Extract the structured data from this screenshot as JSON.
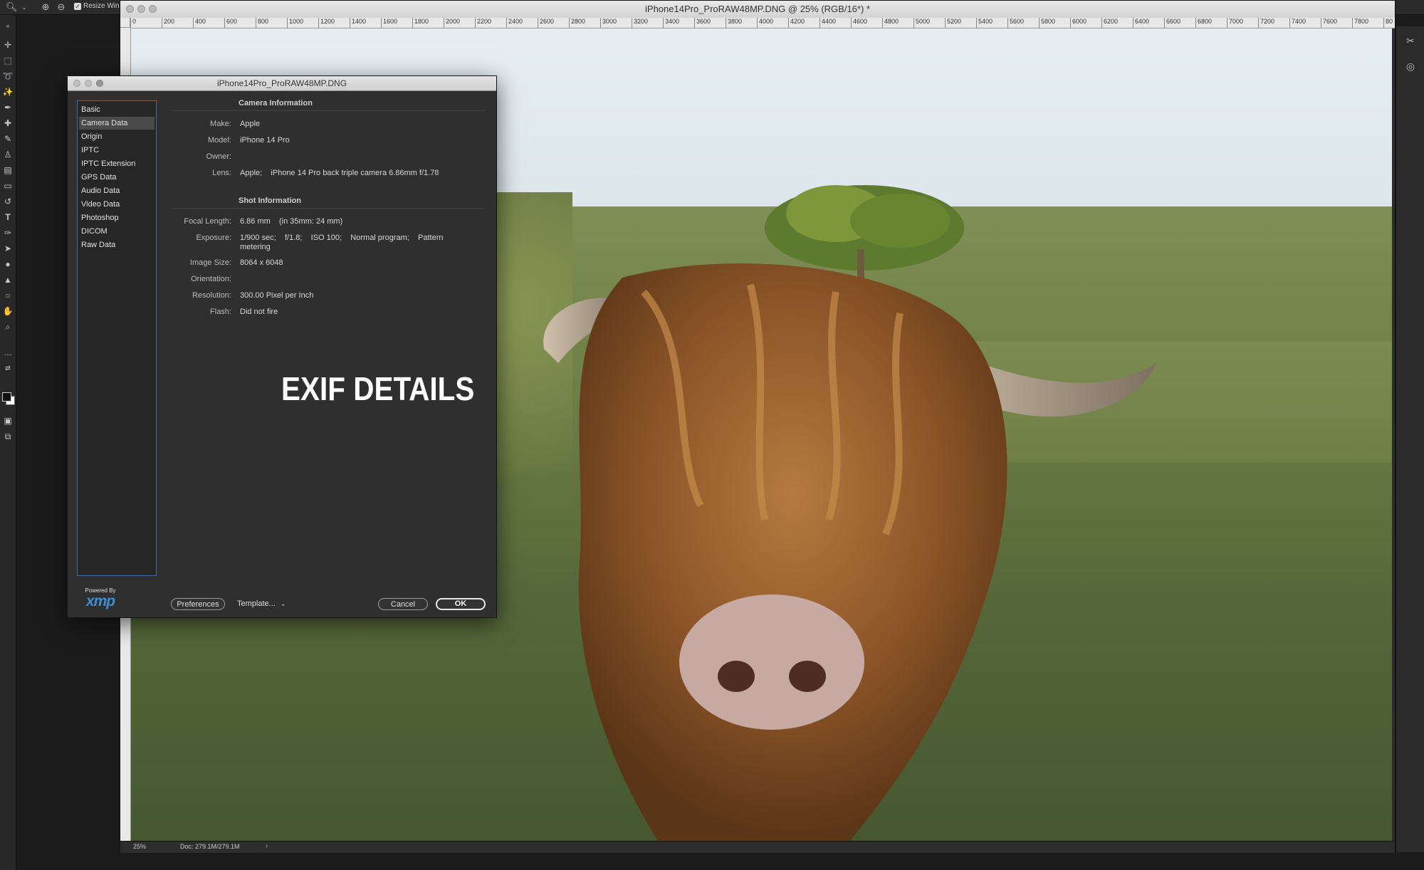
{
  "options_bar": {
    "zoom_icon": "zoom-icon",
    "zoom_in_icon": "zoom-in-icon",
    "zoom_out_icon": "zoom-out-icon",
    "resize_windows_label": "Resize Windows",
    "resize_windows_checked": true
  },
  "document": {
    "title": "iPhone14Pro_ProRAW48MP.DNG @ 25% (RGB/16*) *",
    "ruler_labels": [
      "0",
      "200",
      "400",
      "600",
      "800",
      "1000",
      "1200",
      "1400",
      "1600",
      "1800",
      "2000",
      "2200",
      "2400",
      "2600",
      "2800",
      "3000",
      "3200",
      "3400",
      "3600",
      "3800",
      "4000",
      "4200",
      "4400",
      "4600",
      "4800",
      "5000",
      "5200",
      "5400",
      "5600",
      "5800",
      "6000",
      "6200",
      "6400",
      "6600",
      "6800",
      "7000",
      "7200",
      "7400",
      "7600",
      "7800",
      "80"
    ],
    "zoom_level": "25%",
    "doc_size": "Doc: 279.1M/279.1M"
  },
  "dialog": {
    "title": "iPhone14Pro_ProRAW48MP.DNG",
    "categories": [
      "Basic",
      "Camera Data",
      "Origin",
      "IPTC",
      "IPTC Extension",
      "GPS Data",
      "Audio Data",
      "Video Data",
      "Photoshop",
      "DICOM",
      "Raw Data"
    ],
    "selected_category": "Camera Data",
    "camera_information": {
      "heading": "Camera Information",
      "fields": [
        {
          "label": "Make:",
          "value": "Apple"
        },
        {
          "label": "Model:",
          "value": "iPhone 14 Pro"
        },
        {
          "label": "Owner:",
          "value": ""
        },
        {
          "label": "Lens:",
          "value": "Apple;    iPhone 14 Pro back triple camera 6.86mm f/1.78"
        }
      ]
    },
    "shot_information": {
      "heading": "Shot Information",
      "fields": [
        {
          "label": "Focal Length:",
          "value": "6.86 mm    (in 35mm: 24 mm)"
        },
        {
          "label": "Exposure:",
          "value": "1/900 sec;    f/1.8;    ISO 100;    Normal program;    Pattern metering"
        },
        {
          "label": "Image Size:",
          "value": "8064 x 6048"
        },
        {
          "label": "Orientation:",
          "value": ""
        },
        {
          "label": "Resolution:",
          "value": "300.00 Pixel per Inch"
        },
        {
          "label": "Flash:",
          "value": "Did not fire"
        }
      ]
    },
    "overlay_label": "EXIF DETAILS",
    "powered_by": "Powered By",
    "xmp_logo": "xmp",
    "buttons": {
      "preferences": "Preferences",
      "template": "Template...",
      "cancel": "Cancel",
      "ok": "OK"
    }
  }
}
